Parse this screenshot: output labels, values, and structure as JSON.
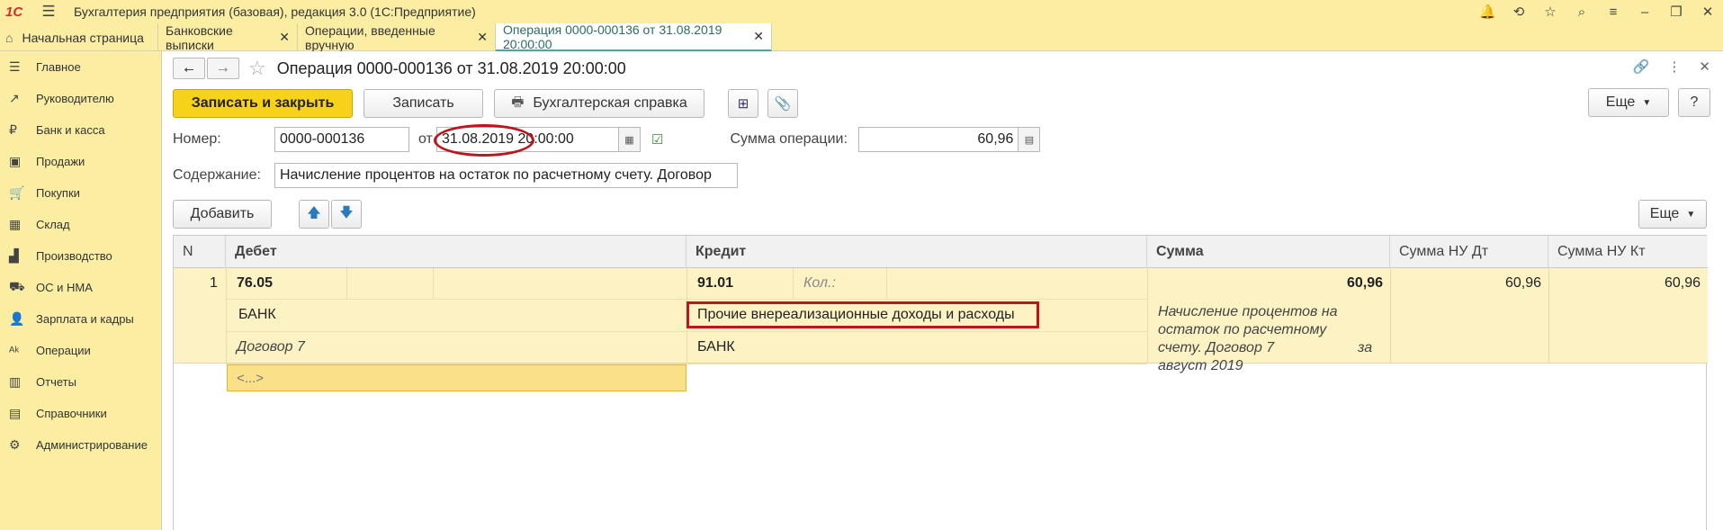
{
  "titlebar": {
    "logo": "1C",
    "title": "Бухгалтерия предприятия (базовая), редакция 3.0  (1С:Предприятие)"
  },
  "tabs": [
    {
      "label": "Начальная страница"
    },
    {
      "label": "Банковские выписки"
    },
    {
      "label": "Операции, введенные вручную"
    },
    {
      "label": "Операция 0000-000136 от 31.08.2019 20:00:00"
    }
  ],
  "sidebar": {
    "items": [
      {
        "label": "Главное",
        "icon": "menu-icon"
      },
      {
        "label": "Руководителю",
        "icon": "chart-icon"
      },
      {
        "label": "Банк и касса",
        "icon": "ruble-icon"
      },
      {
        "label": "Продажи",
        "icon": "bag-icon"
      },
      {
        "label": "Покупки",
        "icon": "cart-icon"
      },
      {
        "label": "Склад",
        "icon": "warehouse-icon"
      },
      {
        "label": "Производство",
        "icon": "factory-icon"
      },
      {
        "label": "ОС и НМА",
        "icon": "truck-icon"
      },
      {
        "label": "Зарплата и кадры",
        "icon": "person-icon"
      },
      {
        "label": "Операции",
        "icon": "operations-icon"
      },
      {
        "label": "Отчеты",
        "icon": "bar-chart-icon"
      },
      {
        "label": "Справочники",
        "icon": "book-icon"
      },
      {
        "label": "Администрирование",
        "icon": "gear-icon"
      }
    ]
  },
  "document": {
    "title": "Операция 0000-000136 от 31.08.2019 20:00:00"
  },
  "toolbar": {
    "save_close": "Записать и закрыть",
    "save": "Записать",
    "report": "Бухгалтерская справка",
    "more": "Еще",
    "help": "?"
  },
  "form": {
    "number_label": "Номер:",
    "number_value": "0000-000136",
    "from_label": "от",
    "date_value": "31.08.2019 20:00:00",
    "sum_label": "Сумма операции:",
    "sum_value": "60,96",
    "content_label": "Содержание:",
    "content_value": "Начисление процентов на остаток по расчетному счету. Договор"
  },
  "table_toolbar": {
    "add": "Добавить",
    "more": "Еще"
  },
  "table": {
    "columns": [
      "N",
      "Дебет",
      "Кредит",
      "Сумма",
      "Сумма НУ Дт",
      "Сумма НУ Кт"
    ],
    "row": {
      "n": "1",
      "debit_account": "76.05",
      "debit_sub1": "БАНК",
      "debit_sub2": "Договор 7",
      "debit_sub3": "<...>",
      "credit_account": "91.01",
      "credit_qty_label": "Кол.:",
      "credit_sub1": "Прочие внереализационные доходы и расходы",
      "credit_sub2": "БАНК",
      "sum": "60,96",
      "sum_desc_1": "Начисление процентов на",
      "sum_desc_2": "остаток по расчетному",
      "sum_desc_3": "счету. Договор 7",
      "sum_desc_3b": "за",
      "sum_desc_4": "август 2019",
      "nu_dt": "60,96",
      "nu_kt": "60,96"
    }
  },
  "colors": {
    "accent": "#f7d21a",
    "panel": "#fbeea2",
    "highlight": "#c0141c",
    "active_tab": "#47a8a8"
  }
}
